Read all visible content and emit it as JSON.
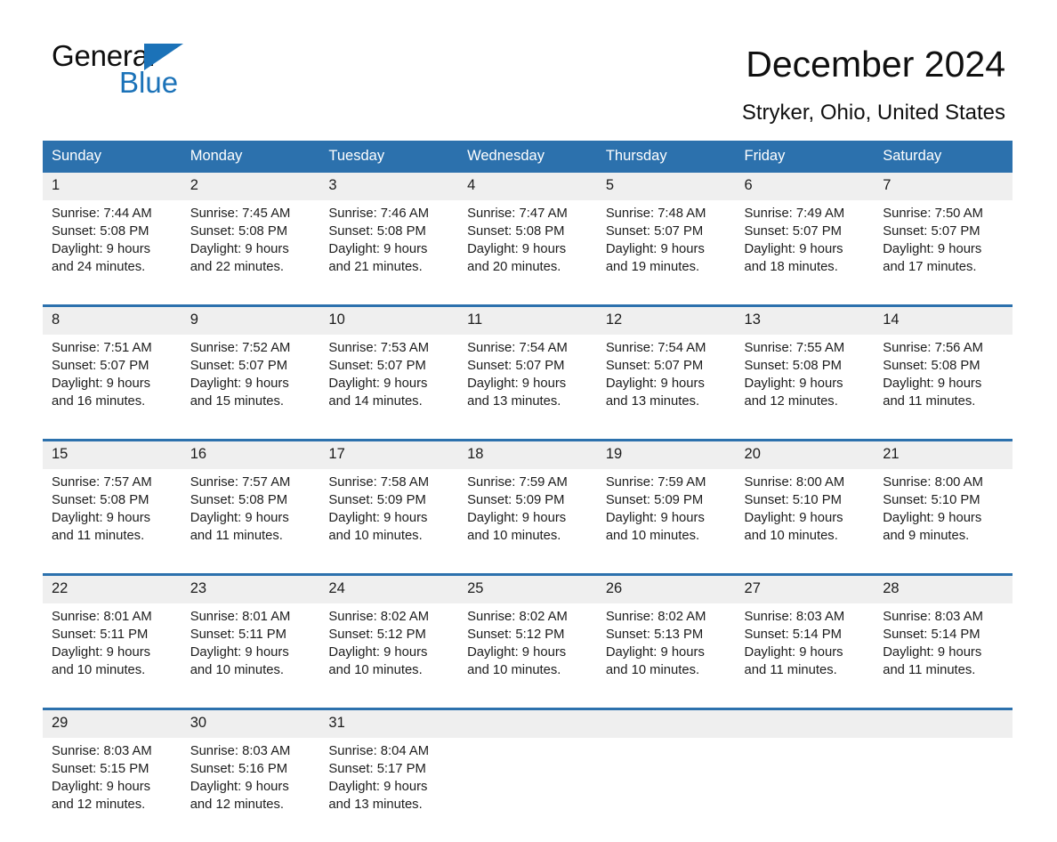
{
  "brand": {
    "name_part1": "General",
    "name_part2": "Blue",
    "triangle_icon": "blue-triangle-icon",
    "accent_color": "#1b72b8"
  },
  "header": {
    "title": "December 2024",
    "subtitle": "Stryker, Ohio, United States"
  },
  "theme": {
    "header_blue": "#2c71ad",
    "daynum_gray": "#efefef",
    "text": "#1c1c1c"
  },
  "calendar": {
    "weekdays": [
      "Sunday",
      "Monday",
      "Tuesday",
      "Wednesday",
      "Thursday",
      "Friday",
      "Saturday"
    ],
    "weeks": [
      [
        {
          "day": "1",
          "sunrise": "Sunrise: 7:44 AM",
          "sunset": "Sunset: 5:08 PM",
          "daylight_l1": "Daylight: 9 hours",
          "daylight_l2": "and 24 minutes."
        },
        {
          "day": "2",
          "sunrise": "Sunrise: 7:45 AM",
          "sunset": "Sunset: 5:08 PM",
          "daylight_l1": "Daylight: 9 hours",
          "daylight_l2": "and 22 minutes."
        },
        {
          "day": "3",
          "sunrise": "Sunrise: 7:46 AM",
          "sunset": "Sunset: 5:08 PM",
          "daylight_l1": "Daylight: 9 hours",
          "daylight_l2": "and 21 minutes."
        },
        {
          "day": "4",
          "sunrise": "Sunrise: 7:47 AM",
          "sunset": "Sunset: 5:08 PM",
          "daylight_l1": "Daylight: 9 hours",
          "daylight_l2": "and 20 minutes."
        },
        {
          "day": "5",
          "sunrise": "Sunrise: 7:48 AM",
          "sunset": "Sunset: 5:07 PM",
          "daylight_l1": "Daylight: 9 hours",
          "daylight_l2": "and 19 minutes."
        },
        {
          "day": "6",
          "sunrise": "Sunrise: 7:49 AM",
          "sunset": "Sunset: 5:07 PM",
          "daylight_l1": "Daylight: 9 hours",
          "daylight_l2": "and 18 minutes."
        },
        {
          "day": "7",
          "sunrise": "Sunrise: 7:50 AM",
          "sunset": "Sunset: 5:07 PM",
          "daylight_l1": "Daylight: 9 hours",
          "daylight_l2": "and 17 minutes."
        }
      ],
      [
        {
          "day": "8",
          "sunrise": "Sunrise: 7:51 AM",
          "sunset": "Sunset: 5:07 PM",
          "daylight_l1": "Daylight: 9 hours",
          "daylight_l2": "and 16 minutes."
        },
        {
          "day": "9",
          "sunrise": "Sunrise: 7:52 AM",
          "sunset": "Sunset: 5:07 PM",
          "daylight_l1": "Daylight: 9 hours",
          "daylight_l2": "and 15 minutes."
        },
        {
          "day": "10",
          "sunrise": "Sunrise: 7:53 AM",
          "sunset": "Sunset: 5:07 PM",
          "daylight_l1": "Daylight: 9 hours",
          "daylight_l2": "and 14 minutes."
        },
        {
          "day": "11",
          "sunrise": "Sunrise: 7:54 AM",
          "sunset": "Sunset: 5:07 PM",
          "daylight_l1": "Daylight: 9 hours",
          "daylight_l2": "and 13 minutes."
        },
        {
          "day": "12",
          "sunrise": "Sunrise: 7:54 AM",
          "sunset": "Sunset: 5:07 PM",
          "daylight_l1": "Daylight: 9 hours",
          "daylight_l2": "and 13 minutes."
        },
        {
          "day": "13",
          "sunrise": "Sunrise: 7:55 AM",
          "sunset": "Sunset: 5:08 PM",
          "daylight_l1": "Daylight: 9 hours",
          "daylight_l2": "and 12 minutes."
        },
        {
          "day": "14",
          "sunrise": "Sunrise: 7:56 AM",
          "sunset": "Sunset: 5:08 PM",
          "daylight_l1": "Daylight: 9 hours",
          "daylight_l2": "and 11 minutes."
        }
      ],
      [
        {
          "day": "15",
          "sunrise": "Sunrise: 7:57 AM",
          "sunset": "Sunset: 5:08 PM",
          "daylight_l1": "Daylight: 9 hours",
          "daylight_l2": "and 11 minutes."
        },
        {
          "day": "16",
          "sunrise": "Sunrise: 7:57 AM",
          "sunset": "Sunset: 5:08 PM",
          "daylight_l1": "Daylight: 9 hours",
          "daylight_l2": "and 11 minutes."
        },
        {
          "day": "17",
          "sunrise": "Sunrise: 7:58 AM",
          "sunset": "Sunset: 5:09 PM",
          "daylight_l1": "Daylight: 9 hours",
          "daylight_l2": "and 10 minutes."
        },
        {
          "day": "18",
          "sunrise": "Sunrise: 7:59 AM",
          "sunset": "Sunset: 5:09 PM",
          "daylight_l1": "Daylight: 9 hours",
          "daylight_l2": "and 10 minutes."
        },
        {
          "day": "19",
          "sunrise": "Sunrise: 7:59 AM",
          "sunset": "Sunset: 5:09 PM",
          "daylight_l1": "Daylight: 9 hours",
          "daylight_l2": "and 10 minutes."
        },
        {
          "day": "20",
          "sunrise": "Sunrise: 8:00 AM",
          "sunset": "Sunset: 5:10 PM",
          "daylight_l1": "Daylight: 9 hours",
          "daylight_l2": "and 10 minutes."
        },
        {
          "day": "21",
          "sunrise": "Sunrise: 8:00 AM",
          "sunset": "Sunset: 5:10 PM",
          "daylight_l1": "Daylight: 9 hours",
          "daylight_l2": "and 9 minutes."
        }
      ],
      [
        {
          "day": "22",
          "sunrise": "Sunrise: 8:01 AM",
          "sunset": "Sunset: 5:11 PM",
          "daylight_l1": "Daylight: 9 hours",
          "daylight_l2": "and 10 minutes."
        },
        {
          "day": "23",
          "sunrise": "Sunrise: 8:01 AM",
          "sunset": "Sunset: 5:11 PM",
          "daylight_l1": "Daylight: 9 hours",
          "daylight_l2": "and 10 minutes."
        },
        {
          "day": "24",
          "sunrise": "Sunrise: 8:02 AM",
          "sunset": "Sunset: 5:12 PM",
          "daylight_l1": "Daylight: 9 hours",
          "daylight_l2": "and 10 minutes."
        },
        {
          "day": "25",
          "sunrise": "Sunrise: 8:02 AM",
          "sunset": "Sunset: 5:12 PM",
          "daylight_l1": "Daylight: 9 hours",
          "daylight_l2": "and 10 minutes."
        },
        {
          "day": "26",
          "sunrise": "Sunrise: 8:02 AM",
          "sunset": "Sunset: 5:13 PM",
          "daylight_l1": "Daylight: 9 hours",
          "daylight_l2": "and 10 minutes."
        },
        {
          "day": "27",
          "sunrise": "Sunrise: 8:03 AM",
          "sunset": "Sunset: 5:14 PM",
          "daylight_l1": "Daylight: 9 hours",
          "daylight_l2": "and 11 minutes."
        },
        {
          "day": "28",
          "sunrise": "Sunrise: 8:03 AM",
          "sunset": "Sunset: 5:14 PM",
          "daylight_l1": "Daylight: 9 hours",
          "daylight_l2": "and 11 minutes."
        }
      ],
      [
        {
          "day": "29",
          "sunrise": "Sunrise: 8:03 AM",
          "sunset": "Sunset: 5:15 PM",
          "daylight_l1": "Daylight: 9 hours",
          "daylight_l2": "and 12 minutes."
        },
        {
          "day": "30",
          "sunrise": "Sunrise: 8:03 AM",
          "sunset": "Sunset: 5:16 PM",
          "daylight_l1": "Daylight: 9 hours",
          "daylight_l2": "and 12 minutes."
        },
        {
          "day": "31",
          "sunrise": "Sunrise: 8:04 AM",
          "sunset": "Sunset: 5:17 PM",
          "daylight_l1": "Daylight: 9 hours",
          "daylight_l2": "and 13 minutes."
        },
        {
          "day": "",
          "sunrise": "",
          "sunset": "",
          "daylight_l1": "",
          "daylight_l2": ""
        },
        {
          "day": "",
          "sunrise": "",
          "sunset": "",
          "daylight_l1": "",
          "daylight_l2": ""
        },
        {
          "day": "",
          "sunrise": "",
          "sunset": "",
          "daylight_l1": "",
          "daylight_l2": ""
        },
        {
          "day": "",
          "sunrise": "",
          "sunset": "",
          "daylight_l1": "",
          "daylight_l2": ""
        }
      ]
    ]
  }
}
